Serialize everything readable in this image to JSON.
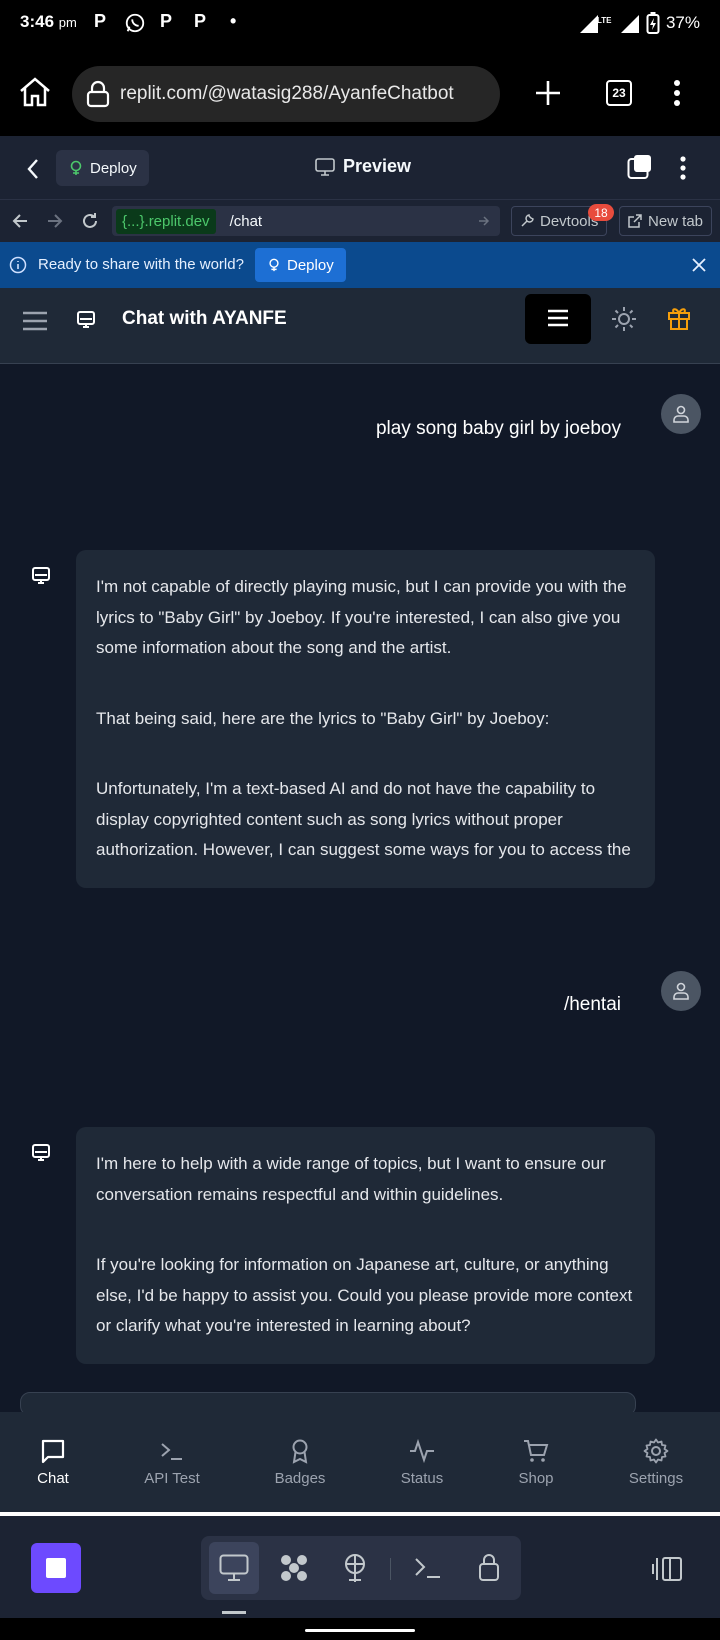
{
  "status_bar": {
    "time": "3:46",
    "ampm": "pm",
    "notifications": [
      "P",
      "WhatsApp",
      "P",
      "P",
      "•"
    ],
    "network": "LTE",
    "battery": "37%"
  },
  "browser": {
    "url": "replit.com/@watasig288/AyanfeChatbot",
    "tab_count": "23"
  },
  "replit_top": {
    "deploy_label": "Deploy",
    "preview_label": "Preview"
  },
  "webview_nav": {
    "host": "{...}.replit.dev",
    "path": "/chat",
    "devtools_label": "Devtools",
    "devtools_badge": "18",
    "new_tab_label": "New tab"
  },
  "banner": {
    "message": "Ready to share with the world?",
    "deploy_label": "Deploy"
  },
  "app_header": {
    "title": "Chat with AYANFE"
  },
  "messages": [
    {
      "role": "user",
      "text": "play song baby girl by joeboy"
    },
    {
      "role": "bot",
      "paragraphs": [
        "I'm not capable of directly playing music, but I can provide you with the lyrics to \"Baby Girl\" by Joeboy. If you're interested, I can also give you some information about the song and the artist.",
        "That being said, here are the lyrics to \"Baby Girl\" by Joeboy:",
        "Unfortunately, I'm a text-based AI and do not have the capability to display copyrighted content such as song lyrics without proper authorization. However, I can suggest some ways for you to access the"
      ]
    },
    {
      "role": "user",
      "text": "/hentai"
    },
    {
      "role": "bot",
      "paragraphs": [
        "I'm here to help with a wide range of topics, but I want to ensure our conversation remains respectful and within guidelines.",
        "If you're looking for information on Japanese art, culture, or anything else, I'd be happy to assist you. Could you please provide more context or clarify what you're interested in learning about?"
      ]
    }
  ],
  "bottom_nav": [
    {
      "label": "Chat",
      "icon": "chat-bubble-icon",
      "active": true
    },
    {
      "label": "API Test",
      "icon": "terminal-icon",
      "active": false
    },
    {
      "label": "Badges",
      "icon": "award-icon",
      "active": false
    },
    {
      "label": "Status",
      "icon": "activity-icon",
      "active": false
    },
    {
      "label": "Shop",
      "icon": "cart-icon",
      "active": false
    },
    {
      "label": "Settings",
      "icon": "gear-icon",
      "active": false
    }
  ],
  "colors": {
    "chat_bg": "#111827",
    "card_bg": "#1f2937",
    "banner_bg": "#0b4a8e",
    "stop_button": "#6d4aff",
    "gift_icon": "#f59e0b"
  }
}
